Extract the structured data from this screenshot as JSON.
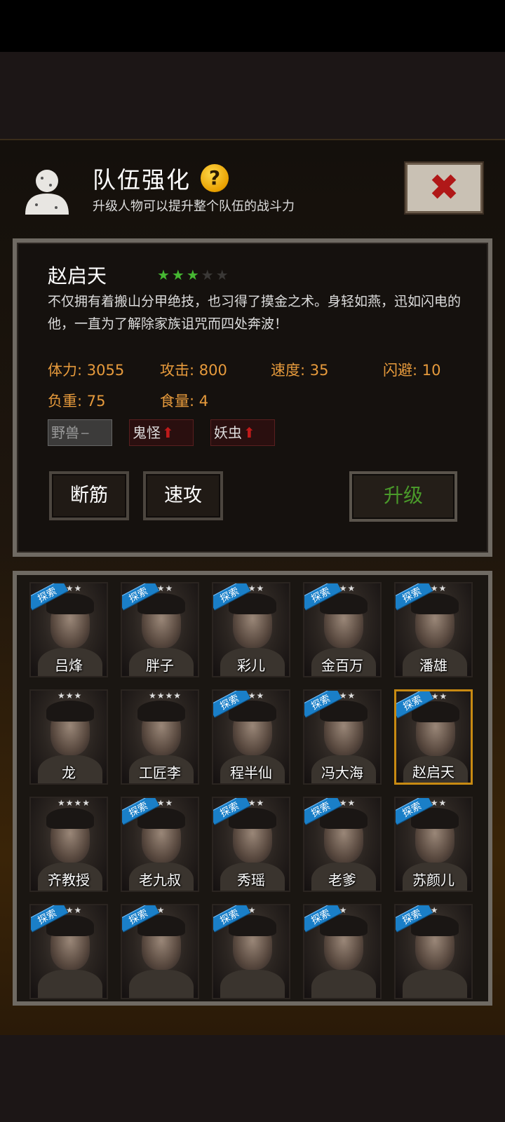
{
  "header": {
    "title": "队伍强化",
    "subtitle": "升级人物可以提升整个队伍的战斗力",
    "help_icon": "?",
    "close_icon": "✖"
  },
  "selected_character": {
    "name": "赵启天",
    "stars_on": "★★★",
    "stars_off": "★★",
    "description": "不仅拥有着搬山分甲绝技，也习得了摸金之术。身轻如燕，迅如闪电的他，一直为了解除家族诅咒而四处奔波！",
    "stats": {
      "stamina": "体力: 3055",
      "attack": "攻击: 800",
      "speed": "速度: 35",
      "dodge": "闪避: 10",
      "load": "负重: 75",
      "food": "食量: 4"
    },
    "tags": [
      {
        "label": "野兽",
        "mark": "--"
      },
      {
        "label": "鬼怪",
        "mark": "⬆"
      },
      {
        "label": "妖虫",
        "mark": "⬆"
      }
    ],
    "skills": [
      "断筋",
      "速攻"
    ],
    "upgrade_label": "升级"
  },
  "roster": {
    "badge_label": "探索",
    "characters": [
      {
        "name": "吕烽",
        "stars": "★★★"
      },
      {
        "name": "胖子",
        "stars": "★★★"
      },
      {
        "name": "彩儿",
        "stars": "★★★"
      },
      {
        "name": "金百万",
        "stars": "★★★"
      },
      {
        "name": "潘雄",
        "stars": "★★★"
      },
      {
        "name": "龙",
        "stars": "★★★"
      },
      {
        "name": "工匠李",
        "stars": "★★★★"
      },
      {
        "name": "程半仙",
        "stars": "★★★"
      },
      {
        "name": "冯大海",
        "stars": "★★★"
      },
      {
        "name": "赵启天",
        "stars": "★★★"
      },
      {
        "name": "齐教授",
        "stars": "★★★★"
      },
      {
        "name": "老九叔",
        "stars": "★★★"
      },
      {
        "name": "秀瑶",
        "stars": "★★★"
      },
      {
        "name": "老爹",
        "stars": "★★★"
      },
      {
        "name": "苏颜儿",
        "stars": "★★★"
      },
      {
        "name": "",
        "stars": "★★★"
      },
      {
        "name": "",
        "stars": "★★"
      },
      {
        "name": "",
        "stars": "★★"
      },
      {
        "name": "",
        "stars": "★★"
      },
      {
        "name": "",
        "stars": "★★"
      }
    ]
  },
  "colors": {
    "stat_orange": "#e69a3c",
    "upgrade_green": "#4a9a2a",
    "star_green": "#46b832",
    "badge_blue": "#1a7fc8",
    "selected_border": "#c88a12"
  }
}
